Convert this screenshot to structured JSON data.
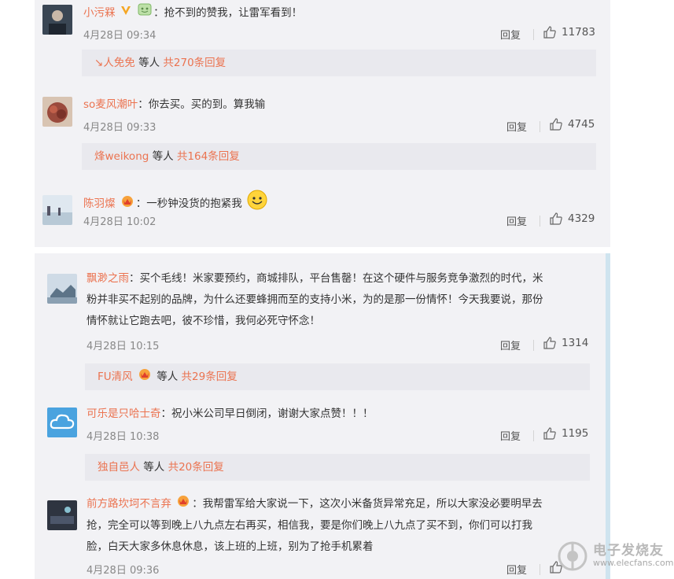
{
  "comments": [
    {
      "username": "小污槑",
      "text": "抢不到的赞我，让雷军看到！",
      "date": "4月28日 09:34",
      "reply_label": "回复",
      "likes": "11783",
      "sub": {
        "arrow": "↘",
        "user": "人免免",
        "mid": " 等人 ",
        "total": "共270条回复"
      },
      "avatar_color": "#3a4654"
    },
    {
      "username": "so麦风潮叶",
      "text": "你去买。买的到。算我输",
      "date": "4月28日 09:33",
      "reply_label": "回复",
      "likes": "4745",
      "sub": {
        "arrow": "",
        "user": "烽weikong",
        "mid": " 等人 ",
        "total": "共164条回复"
      },
      "avatar_color": "#9a4a3c"
    },
    {
      "username": "陈羽燦",
      "text": "一秒钟没货的抱紧我",
      "date": "4月28日 10:02",
      "reply_label": "回复",
      "likes": "4329",
      "avatar_color": "#7fa6c8"
    },
    {
      "username": "飘渺之雨",
      "text_lines": [
        "买个毛线！米家要预约，商城排队，平台售罄！在这个硬件与服务竞争激烈的时代，米",
        "粉并非买不起别的品牌，为什么还要蜂拥而至的支持小米，为的是那一份情怀！今天我要说，那份",
        "情怀就让它跑去吧，彼不珍惜，我何必死守怀念！"
      ],
      "date": "4月28日 10:15",
      "reply_label": "回复",
      "likes": "1314",
      "sub": {
        "arrow": "",
        "user": "FU清风",
        "mid": " 等人 ",
        "total": "共29条回复"
      },
      "avatar_color": "#5d7488"
    },
    {
      "username": "可乐是只哈士奇",
      "text": "祝小米公司早日倒闭，谢谢大家点赞！！！",
      "date": "4月28日 10:38",
      "reply_label": "回复",
      "likes": "1195",
      "sub": {
        "arrow": "",
        "user": "独自邑人",
        "mid": " 等人 ",
        "total": "共20条回复"
      },
      "avatar_color": "#4aa3df"
    },
    {
      "username": "前方路坎坷不言弃",
      "text_lines": [
        "我帮雷军给大家说一下，这次小米备货异常充足，所以大家没必要明早去",
        "抢，完全可以等到晚上八九点左右再买，相信我，要是你们晚上八九点了买不到，你们可以打我",
        "脸，白天大家多休息休息，该上班的上班，别为了抢手机累着"
      ],
      "date": "4月28日 09:36",
      "reply_label": "回复",
      "avatar_color": "#2e3440"
    }
  ],
  "colors": {
    "username": "#eb7350",
    "panel_bg": "#f2f2f5",
    "subbar_bg": "#e9e9ee"
  },
  "watermark": {
    "text": "电子发烧友",
    "url": "www.elecfans.com"
  }
}
